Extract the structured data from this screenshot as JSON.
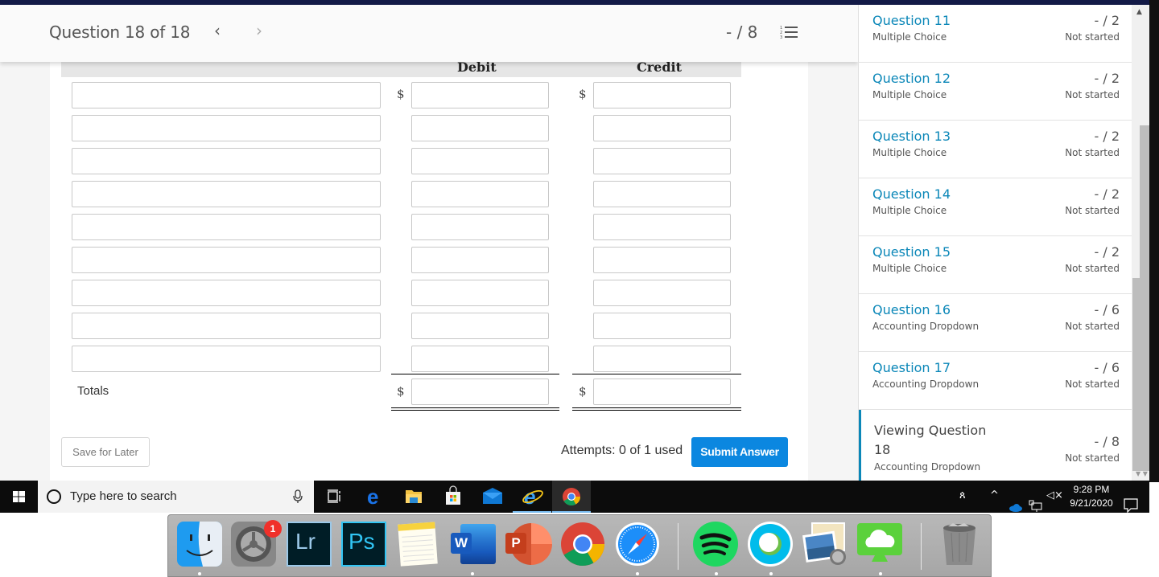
{
  "header": {
    "question_title": "Question 18 of 18",
    "prev_label": "‹",
    "next_label": "›",
    "score": "- / 8",
    "list_icon": "numbered-list-icon"
  },
  "journal": {
    "columns": {
      "account": "",
      "debit": "Debit",
      "credit": "Credit"
    },
    "currency_symbol": "$",
    "row_count": 9,
    "rows": [
      {
        "account": "",
        "debit": "",
        "credit": ""
      },
      {
        "account": "",
        "debit": "",
        "credit": ""
      },
      {
        "account": "",
        "debit": "",
        "credit": ""
      },
      {
        "account": "",
        "debit": "",
        "credit": ""
      },
      {
        "account": "",
        "debit": "",
        "credit": ""
      },
      {
        "account": "",
        "debit": "",
        "credit": ""
      },
      {
        "account": "",
        "debit": "",
        "credit": ""
      },
      {
        "account": "",
        "debit": "",
        "credit": ""
      },
      {
        "account": "",
        "debit": "",
        "credit": ""
      }
    ],
    "totals_label": "Totals",
    "totals": {
      "debit": "",
      "credit": ""
    }
  },
  "footer": {
    "save_label": "Save for Later",
    "attempts": "Attempts: 0 of 1 used",
    "submit_label": "Submit Answer"
  },
  "sidebar": {
    "items": [
      {
        "title": "Question 11",
        "type": "Multiple Choice",
        "points": "- / 2",
        "status": "Not started"
      },
      {
        "title": "Question 12",
        "type": "Multiple Choice",
        "points": "- / 2",
        "status": "Not started"
      },
      {
        "title": "Question 13",
        "type": "Multiple Choice",
        "points": "- / 2",
        "status": "Not started"
      },
      {
        "title": "Question 14",
        "type": "Multiple Choice",
        "points": "- / 2",
        "status": "Not started"
      },
      {
        "title": "Question 15",
        "type": "Multiple Choice",
        "points": "- / 2",
        "status": "Not started"
      },
      {
        "title": "Question 16",
        "type": "Accounting Dropdown",
        "points": "- / 6",
        "status": "Not started"
      },
      {
        "title": "Question 17",
        "type": "Accounting Dropdown",
        "points": "- / 6",
        "status": "Not started"
      },
      {
        "title": "Viewing Question 18",
        "type": "Accounting Dropdown",
        "points": "- / 8",
        "status": "Not started",
        "active": true
      }
    ]
  },
  "taskbar": {
    "search_placeholder": "Type here to search",
    "pinned": [
      "task-view",
      "edge",
      "file-explorer",
      "microsoft-store",
      "mail",
      "internet-explorer",
      "chrome"
    ],
    "time": "9:28 PM",
    "date": "9/21/2020"
  },
  "dock": {
    "apps": [
      "Finder",
      "System Preferences",
      "Lightroom",
      "Photoshop",
      "Notes",
      "Word",
      "PowerPoint",
      "Chrome",
      "Safari",
      "Spotify",
      "Webex",
      "Preview",
      "Cloud App",
      "Trash"
    ],
    "system_prefs_badge": "1",
    "lightroom_label": "Lr",
    "photoshop_label": "Ps",
    "word_label": "W",
    "powerpoint_label": "P"
  },
  "colors": {
    "accent": "#0b87b8",
    "submit": "#0b87e0",
    "topbar": "#131a47"
  }
}
